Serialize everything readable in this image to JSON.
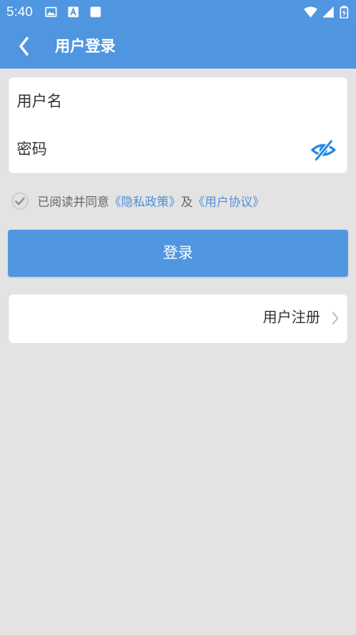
{
  "status_bar": {
    "time": "5:40",
    "left_icons": [
      "image-icon",
      "text-a-icon",
      "square-icon"
    ],
    "right_icons": [
      "wifi-icon",
      "signal-icon",
      "battery-charging-icon"
    ]
  },
  "app_bar": {
    "title": "用户登录",
    "back_icon": "chevron-left-icon",
    "background": "#4f95df"
  },
  "form": {
    "username_label": "用户名",
    "username_value": "",
    "password_label": "密码",
    "password_value": "",
    "eye_icon": "eye-off-icon"
  },
  "agreement": {
    "prefix": "已阅读并同意",
    "privacy_link": "《隐私政策》",
    "connector": "及",
    "user_agreement_link": "《用户协议》",
    "link_color": "#4f8fd8"
  },
  "login_button": {
    "label": "登录",
    "color": "#5096e0"
  },
  "register": {
    "label": "用户注册",
    "icon": "chevron-right-icon"
  },
  "colors": {
    "page_background": "#e3e3e3",
    "card_background": "#ffffff",
    "accent": "#4f95df",
    "text": "#333333",
    "muted_text": "#666666"
  }
}
